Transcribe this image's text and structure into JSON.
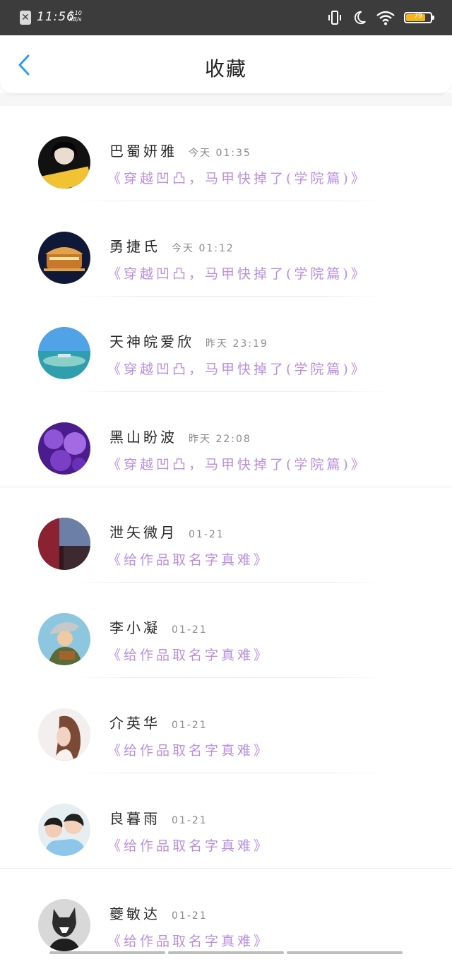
{
  "status_bar": {
    "time": "11:56",
    "speed_value": "6.10",
    "speed_unit": "KB/s",
    "battery": "79",
    "battery_level": 0.79,
    "icons": [
      "close-icon",
      "vibrate-icon",
      "moon-icon",
      "wifi-icon",
      "battery-icon"
    ]
  },
  "header": {
    "title": "收藏",
    "back_icon": "chevron-left-icon"
  },
  "colors": {
    "accent": "#2a9df4",
    "work_title": "#b98fde",
    "status_bar_bg": "#3c3c3c",
    "battery_fill": "#f5b51b"
  },
  "items": [
    {
      "name": "巴蜀妍雅",
      "time": "今天 01:35",
      "work": "《穿越凹凸，马甲快掉了(学院篇)》"
    },
    {
      "name": "勇捷氏",
      "time": "今天 01:12",
      "work": "《穿越凹凸，马甲快掉了(学院篇)》"
    },
    {
      "name": "天神皖爱欣",
      "time": "昨天 23:19",
      "work": "《穿越凹凸，马甲快掉了(学院篇)》"
    },
    {
      "name": "黑山盼波",
      "time": "昨天 22:08",
      "work": "《穿越凹凸，马甲快掉了(学院篇)》"
    },
    {
      "name": "泄矢微月",
      "time": "01-21",
      "work": "《给作品取名字真难》"
    },
    {
      "name": "李小凝",
      "time": "01-21",
      "work": "《给作品取名字真难》"
    },
    {
      "name": "介英华",
      "time": "01-21",
      "work": "《给作品取名字真难》"
    },
    {
      "name": "良暮雨",
      "time": "01-21",
      "work": "《给作品取名字真难》"
    },
    {
      "name": "夔敏达",
      "time": "01-21",
      "work": "《给作品取名字真难》"
    }
  ]
}
